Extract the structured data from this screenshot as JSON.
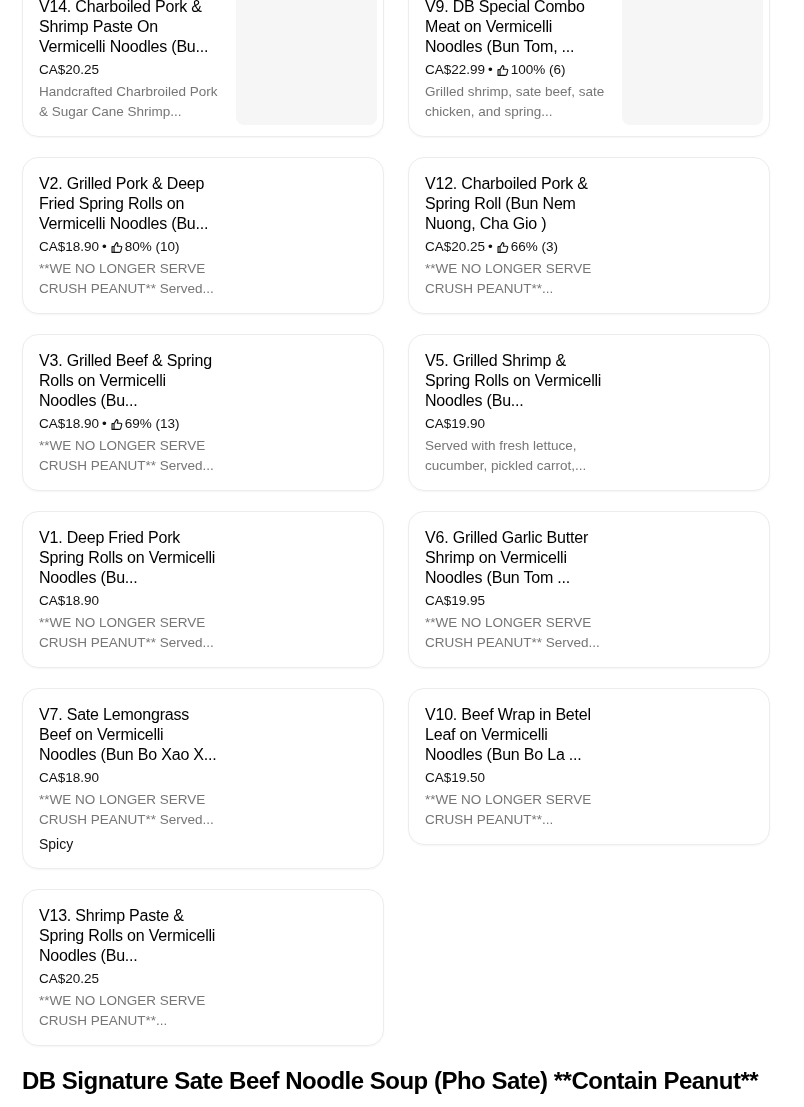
{
  "items": [
    {
      "title": "V14. Charboiled Pork & Shrimp Paste On Vermicelli Noodles (Bu...",
      "price": "CA$20.25",
      "description": "Handcrafted Charbroiled Pork & Sugar Cane Shrimp...",
      "has_image": true
    },
    {
      "title": "V9. DB Special Combo Meat on Vermicelli Noodles (Bun Tom, ...",
      "price": "CA$22.99",
      "separator": "•",
      "rating": "100% (6)",
      "description": "Grilled shrimp, sate beef, sate chicken, and spring...",
      "has_image": true
    },
    {
      "title": "V2. Grilled Pork & Deep Fried Spring Rolls on Vermicelli Noodles (Bu...",
      "price": "CA$18.90",
      "separator": "•",
      "rating": "80% (10)",
      "description": "**WE NO LONGER SERVE CRUSH PEANUT** Served..."
    },
    {
      "title": "V12. Charboiled Pork & Spring Roll (Bun Nem Nuong, Cha Gio )",
      "price": "CA$20.25",
      "separator": "•",
      "rating": "66% (3)",
      "description": "**WE NO LONGER SERVE CRUSH PEANUT**..."
    },
    {
      "title": "V3. Grilled Beef & Spring Rolls on Vermicelli Noodles (Bu...",
      "price": "CA$18.90",
      "separator": "•",
      "rating": "69% (13)",
      "description": "**WE NO LONGER SERVE CRUSH PEANUT** Served..."
    },
    {
      "title": "V5. Grilled Shrimp & Spring Rolls on Vermicelli Noodles (Bu...",
      "price": "CA$19.90",
      "description": "Served with fresh lettuce, cucumber, pickled carrot,..."
    },
    {
      "title": "V1. Deep Fried Pork Spring Rolls on Vermicelli Noodles (Bu...",
      "price": "CA$18.90",
      "description": "**WE NO LONGER SERVE CRUSH PEANUT** Served..."
    },
    {
      "title": "V6. Grilled Garlic Butter Shrimp on Vermicelli Noodles (Bun Tom ...",
      "price": "CA$19.95",
      "description": "**WE NO LONGER SERVE CRUSH PEANUT** Served..."
    },
    {
      "title": "V7. Sate Lemongrass Beef on Vermicelli Noodles (Bun Bo Xao X...",
      "price": "CA$18.90",
      "description": "**WE NO LONGER SERVE CRUSH PEANUT** Served...",
      "tag": "Spicy"
    },
    {
      "title": "V10. Beef Wrap in Betel Leaf on Vermicelli Noodles (Bun Bo La ...",
      "price": "CA$19.50",
      "description": "**WE NO LONGER SERVE CRUSH PEANUT**..."
    },
    {
      "title": "V13. Shrimp Paste & Spring Rolls on Vermicelli Noodles (Bu...",
      "price": "CA$20.25",
      "description": "**WE NO LONGER SERVE CRUSH PEANUT**..."
    }
  ],
  "next_section": {
    "title": "DB Signature Sate Beef Noodle Soup (Pho Sate) **Contain Peanut**"
  }
}
